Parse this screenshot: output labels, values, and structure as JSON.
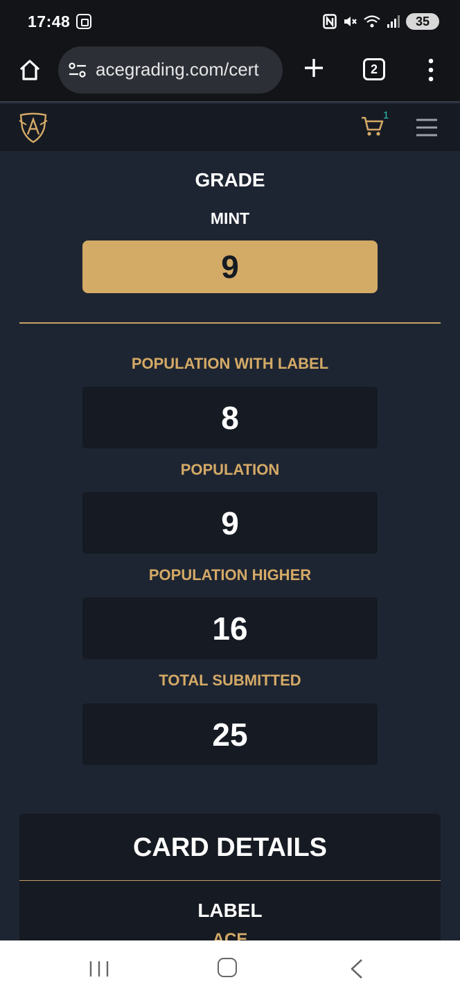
{
  "status_bar": {
    "time": "17:48",
    "battery": "35",
    "icons": [
      "screenshot-icon",
      "nfc-icon",
      "mute-icon",
      "wifi-icon",
      "signal-icon",
      "battery-icon"
    ]
  },
  "browser": {
    "url": "acegrading.com/cert",
    "tab_count": "2"
  },
  "site_header": {
    "cart_count": "1"
  },
  "grade": {
    "title": "GRADE",
    "subtitle": "MINT",
    "value": "9"
  },
  "stats": [
    {
      "label": "POPULATION WITH LABEL",
      "value": "8"
    },
    {
      "label": "POPULATION",
      "value": "9"
    },
    {
      "label": "POPULATION HIGHER",
      "value": "16"
    },
    {
      "label": "TOTAL SUBMITTED",
      "value": "25"
    }
  ],
  "card_details": {
    "title": "CARD DETAILS",
    "label_heading": "LABEL",
    "label_value": "ACE"
  },
  "colors": {
    "accent_gold": "#d4aa67",
    "background": "#1e2532",
    "box_dark": "#151a23",
    "cart_badge": "#2bc4b4"
  }
}
